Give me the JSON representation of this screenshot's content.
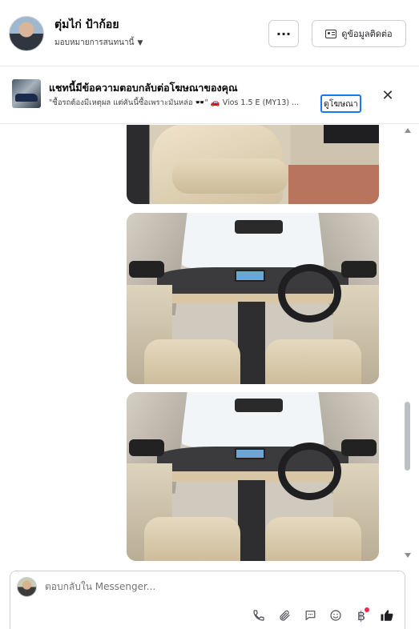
{
  "header": {
    "name": "ตุ่มไก่ ป้าก้อย",
    "assign_label": "มอบหมายการสนทนานี้",
    "more_label": "···",
    "contact_label": "ดูข้อมูลติดต่อ"
  },
  "ad": {
    "title": "แชทนี้มีข้อความตอบกลับต่อโฆษณาของคุณ",
    "subtitle": "\"ซื้อรถต้องมีเหตุผล แต่คันนี้ซื้อเพราะมันหล่อ 🕶️\" 🚗 Vios 1.5 E (MY13) ...",
    "link_label": "ดูโฆษณา",
    "close_label": "✕"
  },
  "composer": {
    "placeholder": "ตอบกลับใน Messenger..."
  },
  "icons": {
    "phone": "phone-icon",
    "attach": "paperclip-icon",
    "saved": "saved-reply-icon",
    "emoji": "emoji-icon",
    "payment": "baht-icon",
    "like": "thumbs-up-icon"
  },
  "colors": {
    "accent": "#1877f2",
    "notification_dot": "#f02849"
  }
}
